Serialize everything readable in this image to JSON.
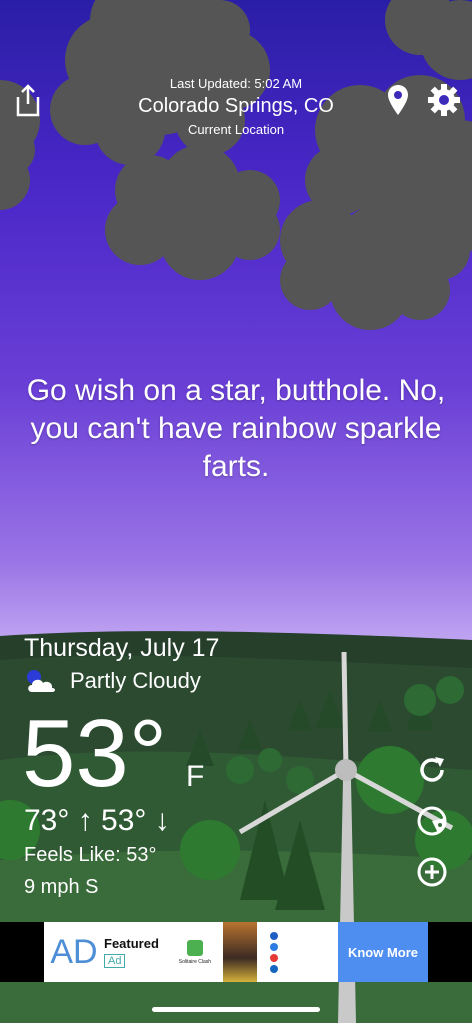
{
  "header": {
    "last_updated": "Last Updated: 5:02 AM",
    "city": "Colorado Springs, CO",
    "location_label": "Current Location"
  },
  "quote": "Go wish on a star, butthole. No, you can't have rainbow sparkle farts.",
  "weather": {
    "date": "Thursday, July 17",
    "condition": "Partly Cloudy",
    "temperature": "53°",
    "unit": "F",
    "high_low": "73° ↑  53° ↓",
    "feels_like": "Feels Like: 53°",
    "wind": "9 mph S"
  },
  "ad": {
    "logo_text": "AD",
    "featured": "Featured",
    "tag": "Ad",
    "cta": "Know More",
    "thumb_caption": "Solitaire Clash"
  },
  "colors": {
    "sky_top": "#2a1ea6",
    "sky_bottom": "#d9c6f6",
    "cloud": "#555555",
    "hill_dark": "#1e3a24",
    "cta_blue": "#4d8ef0"
  },
  "icons": [
    "share-icon",
    "location-pin-icon",
    "gear-icon",
    "partly-cloudy-icon",
    "refresh-icon",
    "radar-icon",
    "add-icon"
  ]
}
